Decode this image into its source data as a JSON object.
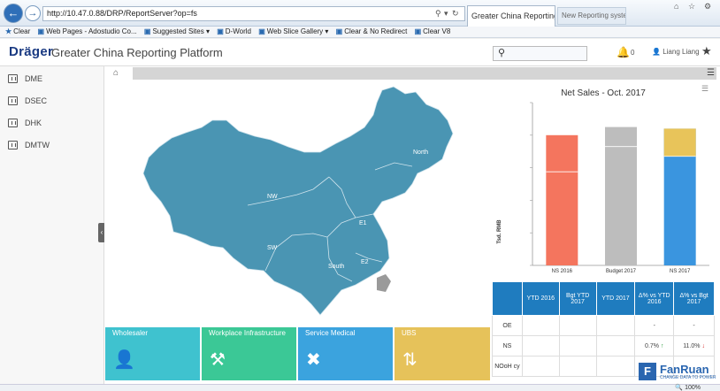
{
  "browser": {
    "address": "http://10.47.0.88/DRP/ReportServer?op=fs",
    "tab_active": "Greater China Reporting Pla...",
    "tab_inactive": "New Reporting system pro..."
  },
  "favorites": [
    {
      "label": "Clear"
    },
    {
      "label": "Web Pages - Adostudio Co..."
    },
    {
      "label": "Suggested Sites ▾"
    },
    {
      "label": "D-World"
    },
    {
      "label": "Web Slice Gallery ▾"
    },
    {
      "label": "Clear & No Redirect"
    },
    {
      "label": "Clear V8"
    }
  ],
  "header": {
    "logo": "Dräger",
    "title": "Greater China Reporting Platform",
    "search_icon": "search-icon",
    "notification_count": "0",
    "user_name": "Liang Liang"
  },
  "sidebar": {
    "items": [
      {
        "label": "DME",
        "icon": "dashboard-icon"
      },
      {
        "label": "DSEC",
        "icon": "dashboard-icon"
      },
      {
        "label": "DHK",
        "icon": "dashboard-icon"
      },
      {
        "label": "DMTW",
        "icon": "dashboard-icon"
      }
    ]
  },
  "map": {
    "fill_color": "#4a95b3",
    "regions": [
      {
        "name": "North"
      },
      {
        "name": "NW"
      },
      {
        "name": "E1"
      },
      {
        "name": "SW"
      },
      {
        "name": "E2"
      },
      {
        "name": "South"
      }
    ]
  },
  "chart_data": {
    "type": "bar",
    "title": "Net Sales - Oct. 2017",
    "ylabel": "Tsd. RMB",
    "categories": [
      "NS 2016",
      "Budget 2017",
      "NS 2017"
    ],
    "colors": [
      "#f4755e",
      "#bdbdbd",
      "#3a95df"
    ],
    "totals": [
      8000,
      8500,
      8400
    ],
    "lower_segments": [
      5750,
      7300,
      6700
    ],
    "ylim": [
      0,
      10000
    ],
    "accent_top_color": "#e8c45a"
  },
  "tiles": [
    {
      "label": "Wholesaler",
      "color": "#3fc2cf",
      "icon": "user-icon"
    },
    {
      "label": "Workplace Infrastructure",
      "color": "#3bc896",
      "icon": "tools-icon"
    },
    {
      "label": "Service Medical",
      "color": "#3ba3de",
      "icon": "wrench-icon"
    },
    {
      "label": "UBS",
      "color": "#e6c25a",
      "icon": "exchange-icon"
    }
  ],
  "table": {
    "headers": [
      "",
      "YTD 2016",
      "Bgt YTD 2017",
      "YTD 2017",
      "Δ% vs YTD 2016",
      "Δ% vs Bgt 2017"
    ],
    "rows": [
      {
        "label": "OE",
        "c4": "-",
        "c6": "-"
      },
      {
        "label": "NS",
        "c4": "0.7%",
        "c4_arrow": "up",
        "c6": "11.0%",
        "c6_arrow": "down"
      },
      {
        "label": "NOoH cy"
      }
    ]
  },
  "watermark": {
    "letter": "F",
    "name": "FanRuan",
    "tagline": "CHANGE DATA TO POWER"
  },
  "status": {
    "zoom": "100%"
  }
}
